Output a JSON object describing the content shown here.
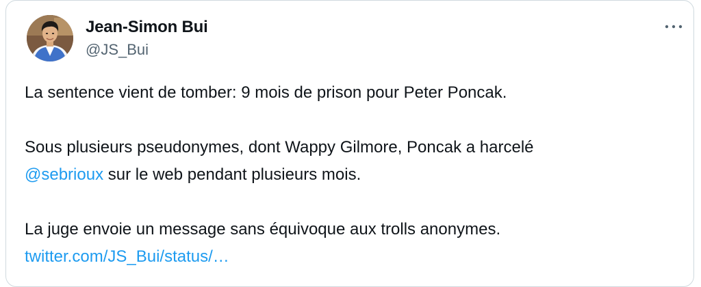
{
  "author": {
    "display_name": "Jean-Simon Bui",
    "handle": "@JS_Bui",
    "avatar_icon": "profile-photo"
  },
  "more_icon": "ellipsis-icon",
  "tweet": {
    "line1": "La sentence vient de tomber: 9 mois de prison pour Peter Poncak.",
    "line2": "Sous plusieurs pseudonymes, dont Wappy Gilmore, Poncak a harcelé",
    "mention": "@sebrioux",
    "line3_rest": " sur le web pendant plusieurs mois.",
    "line4": "La juge envoie un message sans équivoque aux trolls anonymes.",
    "link": "twitter.com/JS_Bui/status/…"
  },
  "colors": {
    "text": "#0f1419",
    "secondary": "#536471",
    "link": "#1d9bf0",
    "border": "#cfd9de"
  }
}
